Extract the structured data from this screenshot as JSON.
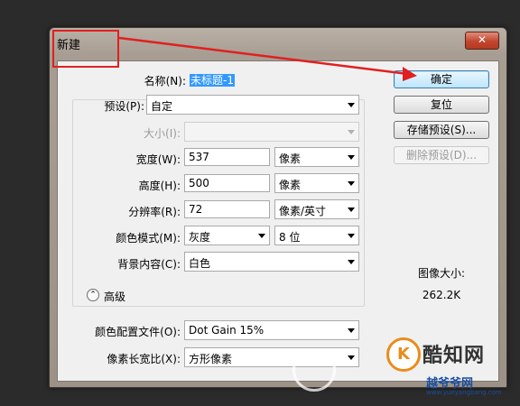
{
  "window": {
    "title": "新建",
    "close_glyph": "✕"
  },
  "form": {
    "name": {
      "label": "名称(N):",
      "value": "未标题-1"
    },
    "preset": {
      "label": "预设(P):",
      "value": "自定"
    },
    "size": {
      "label": "大小(I):",
      "value": ""
    },
    "width": {
      "label": "宽度(W):",
      "value": "537",
      "unit": "像素"
    },
    "height": {
      "label": "高度(H):",
      "value": "500",
      "unit": "像素"
    },
    "resolution": {
      "label": "分辨率(R):",
      "value": "72",
      "unit": "像素/英寸"
    },
    "color_mode": {
      "label": "颜色模式(M):",
      "value": "灰度",
      "depth": "8 位"
    },
    "background": {
      "label": "背景内容(C):",
      "value": "白色"
    },
    "advanced": {
      "label": "高级",
      "icon": "chevron-up-icon",
      "glyph": "⌃"
    },
    "color_profile": {
      "label": "颜色配置文件(O):",
      "value": "Dot Gain 15%"
    },
    "pixel_aspect": {
      "label": "像素长宽比(X):",
      "value": "方形像素"
    }
  },
  "buttons": {
    "ok": "确定",
    "reset": "复位",
    "save_preset": "存储预设(S)...",
    "delete_preset": "删除预设(D)..."
  },
  "image_size": {
    "label": "图像大小:",
    "value": "262.2K"
  },
  "watermark": {
    "logo_glyph": "K",
    "brand": "酷知网",
    "site_name": "越爷爷网",
    "site_url": "www.yueyangbang.com"
  },
  "colors": {
    "annotation": "#e02020",
    "accent": "#3c7fb1",
    "brand_orange": "#e98c1a"
  }
}
